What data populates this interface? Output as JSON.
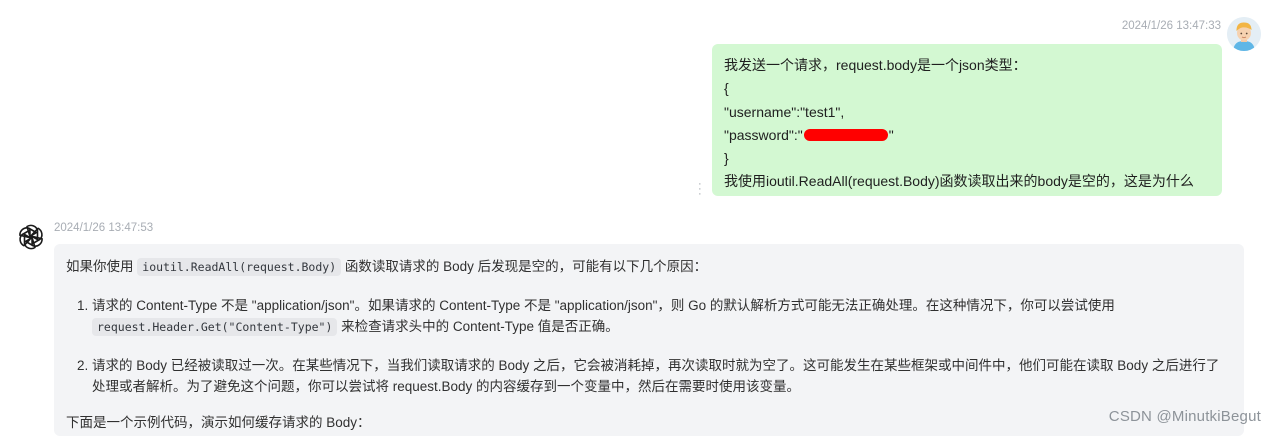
{
  "user_message": {
    "timestamp": "2024/1/26 13:47:33",
    "lines": [
      "我发送一个请求，request.body是一个json类型：",
      "{",
      "\"username\":\"test1\",",
      "\"password\":\"",
      "}",
      "我使用ioutil.ReadAll(request.Body)函数读取出来的body是空的，这是为什么"
    ],
    "password_suffix": "\""
  },
  "bot_message": {
    "timestamp": "2024/1/26 13:47:53",
    "intro": {
      "before": "如果你使用 ",
      "code": "ioutil.ReadAll(request.Body)",
      "after": " 函数读取请求的 Body 后发现是空的，可能有以下几个原因："
    },
    "items": [
      {
        "before": "请求的 Content-Type 不是 \"application/json\"。如果请求的 Content-Type 不是 \"application/json\"，则 Go 的默认解析方式可能无法正确处理。在这种情况下，你可以尝试使用 ",
        "code": "request.Header.Get(\"Content-Type\")",
        "after": " 来检查请求头中的 Content-Type 值是否正确。"
      },
      {
        "text": "请求的 Body 已经被读取过一次。在某些情况下，当我们读取请求的 Body 之后，它会被消耗掉，再次读取时就为空了。这可能发生在某些框架或中间件中，他们可能在读取 Body 之后进行了处理或者解析。为了避免这个问题，你可以尝试将 request.Body 的内容缓存到一个变量中，然后在需要时使用该变量。"
      }
    ],
    "outro": "下面是一个示例代码，演示如何缓存请求的 Body："
  },
  "icons": {
    "user_avatar": "user-avatar-icon",
    "bot_avatar": "chatgpt-logo-icon",
    "more": "more-vertical-icon"
  },
  "colors": {
    "user_bubble": "#d3f8d2",
    "bot_bubble": "#f3f4f6",
    "redaction": "#ff0000"
  },
  "watermark": "CSDN @MinutkiBegut"
}
